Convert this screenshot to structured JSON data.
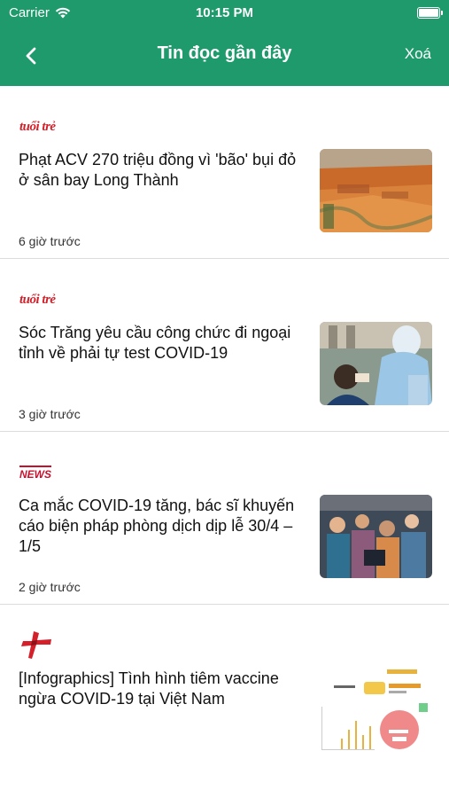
{
  "status_bar": {
    "carrier": "Carrier",
    "time": "10:15 PM"
  },
  "header": {
    "title": "Tin đọc gần đây",
    "clear_label": "Xoá"
  },
  "colors": {
    "brand": "#1f9a6c",
    "text": "#111111",
    "divider": "#dcdcdc"
  },
  "articles": [
    {
      "source_logo": "tuoitre",
      "source_text": "tuổi trẻ",
      "title": "Phạt ACV 270 triệu đồng vì 'bão' bụi đỏ ở sân bay Long Thành",
      "time": "6 giờ trước"
    },
    {
      "source_logo": "tuoitre",
      "source_text": "tuổi trẻ",
      "title": "Sóc Trăng yêu cầu công chức đi ngoại tỉnh về phải tự test COVID-19",
      "time": "3 giờ trước"
    },
    {
      "source_logo": "news",
      "source_text": "NEWS",
      "title": "Ca mắc COVID-19 tăng, bác sĩ khuyến cáo biện pháp phòng dịch dịp lễ 30/4 – 1/5",
      "time": "2 giờ trước"
    },
    {
      "source_logo": "cross",
      "title": "[Infographics] Tình hình tiêm vaccine ngừa COVID-19 tại Việt Nam"
    }
  ]
}
